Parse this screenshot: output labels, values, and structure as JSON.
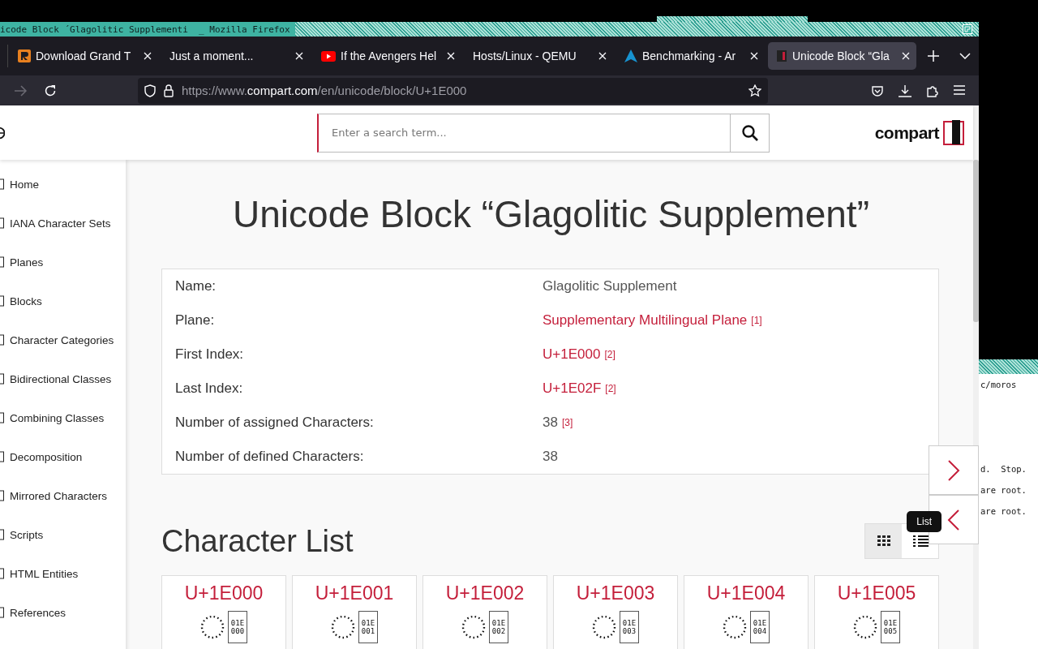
{
  "browser": {
    "title_bar": {
      "title": "icode Block ´Glagolitic Supplementi  _ Mozilla Firefox"
    },
    "tabs": [
      {
        "title": "Download Grand T",
        "kind": "r",
        "selected": false
      },
      {
        "title": "Just a moment...",
        "kind": "plain",
        "selected": false
      },
      {
        "title": "If the Avengers Hel",
        "kind": "video",
        "selected": false
      },
      {
        "title": "Hosts/Linux - QEMU",
        "kind": "plain",
        "selected": false
      },
      {
        "title": "Benchmarking - Ar",
        "kind": "peak",
        "selected": false
      },
      {
        "title": "Unicode Block “Gla",
        "kind": "site",
        "selected": true
      }
    ],
    "forward_button": {
      "disabled": true
    },
    "url": {
      "scheme": "https://www.",
      "domain": "compart.com",
      "path": "/en/unicode/block/U+1E000"
    }
  },
  "page": {
    "search": {
      "placeholder": "Enter a search term..."
    },
    "logo": {
      "text": "compart"
    },
    "sidebar": [
      {
        "label": "Home"
      },
      {
        "label": "IANA Character Sets"
      },
      {
        "label": "Planes"
      },
      {
        "label": "Blocks"
      },
      {
        "label": "Character Categories"
      },
      {
        "label": "Bidirectional Classes"
      },
      {
        "label": "Combining Classes"
      },
      {
        "label": "Decomposition"
      },
      {
        "label": "Mirrored Characters"
      },
      {
        "label": "Scripts"
      },
      {
        "label": "HTML Entities"
      },
      {
        "label": "References"
      }
    ],
    "heading": "Unicode Block “Glagolitic Supplement”",
    "info": [
      {
        "label": "Name:",
        "value": "Glagolitic Supplement",
        "kind": "text"
      },
      {
        "label": "Plane:",
        "value": "Supplementary Multilingual Plane",
        "note": "[1]",
        "kind": "link"
      },
      {
        "label": "First Index:",
        "value": "U+1E000",
        "note": "[2]",
        "kind": "link"
      },
      {
        "label": "Last Index:",
        "value": "U+1E02F",
        "note": "[2]",
        "kind": "link"
      },
      {
        "label": "Number of assigned Characters:",
        "value": "38",
        "note": "[3]",
        "kind": "text"
      },
      {
        "label": "Number of defined Characters:",
        "value": "38",
        "kind": "text"
      }
    ],
    "list_heading": "Character List",
    "view_toggle": [
      {
        "kind": "grid",
        "selected": true
      },
      {
        "kind": "list",
        "selected": false
      }
    ],
    "tooltip": "List",
    "characters": [
      {
        "code": "U+1E000",
        "glyph_code": [
          "01E",
          "000"
        ]
      },
      {
        "code": "U+1E001",
        "glyph_code": [
          "01E",
          "001"
        ]
      },
      {
        "code": "U+1E002",
        "glyph_code": [
          "01E",
          "002"
        ]
      },
      {
        "code": "U+1E003",
        "glyph_code": [
          "01E",
          "003"
        ]
      },
      {
        "code": "U+1E004",
        "glyph_code": [
          "01E",
          "004"
        ]
      },
      {
        "code": "U+1E005",
        "glyph_code": [
          "01E",
          "005"
        ]
      }
    ]
  },
  "terminal": {
    "path_line": "c/moros",
    "messages": [
      "d.  Stop.",
      "are root.",
      "are root."
    ]
  }
}
